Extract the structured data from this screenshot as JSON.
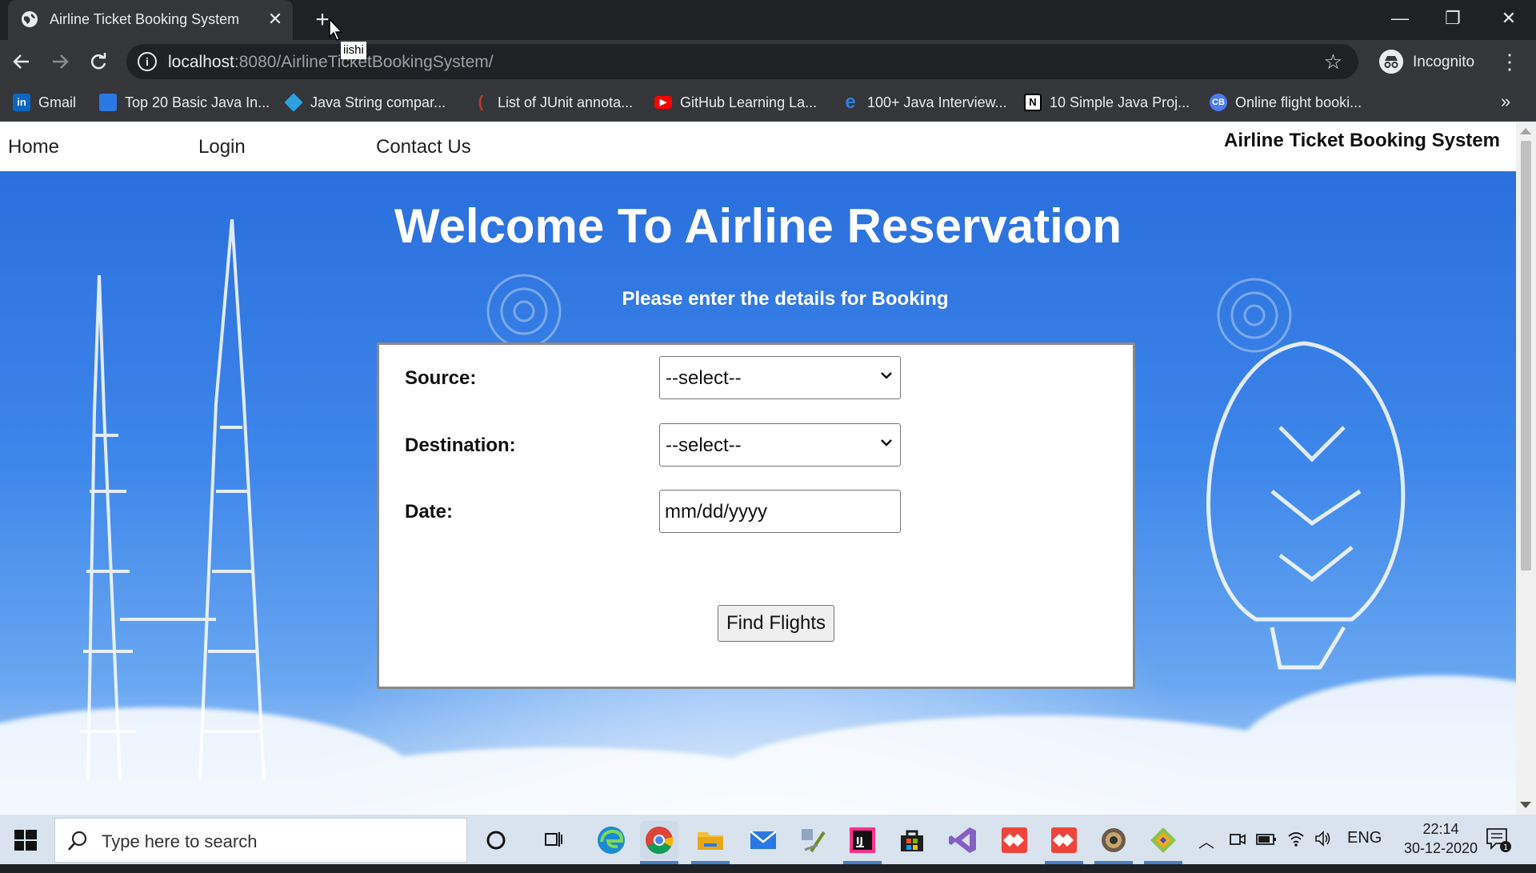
{
  "browser": {
    "tab_title": "Airline Ticket Booking System",
    "tab_close": "✕",
    "new_tab": "+",
    "tooltip": "iishi",
    "url_host": "localhost",
    "url_rest": ":8080/AirlineTicketBookingSystem/",
    "incognito_label": "Incognito",
    "window_controls": {
      "minimize": "—",
      "restore": "❐",
      "close": "✕"
    }
  },
  "bookmarks": [
    {
      "label": "Gmail",
      "icon": "linkedin-icon",
      "color": "#0a66c2",
      "glyph": "in"
    },
    {
      "label": "Top 20 Basic Java In...",
      "icon": "page-icon",
      "color": "#2b78e4",
      "glyph": ""
    },
    {
      "label": "Java String compar...",
      "icon": "diamond-icon",
      "color": "#2ea0e0",
      "glyph": ""
    },
    {
      "label": "List of JUnit annota...",
      "icon": "moon-icon",
      "color": "#7a2f2f",
      "glyph": "("
    },
    {
      "label": "GitHub Learning La...",
      "icon": "youtube-icon",
      "color": "#ff0000",
      "glyph": "▶"
    },
    {
      "label": "100+ Java Interview...",
      "icon": "edge-icon",
      "color": "#2f7fd6",
      "glyph": "e"
    },
    {
      "label": "10 Simple Java Proj...",
      "icon": "notion-icon",
      "color": "#ffffff",
      "glyph": "N"
    },
    {
      "label": "Online flight booki...",
      "icon": "cb-icon",
      "color": "#4b7bec",
      "glyph": "CB"
    }
  ],
  "bookmarks_more": "»",
  "site": {
    "nav": {
      "home": "Home",
      "login": "Login",
      "contact": "Contact Us"
    },
    "brand": "Airline Ticket Booking System",
    "heading": "Welcome To Airline Reservation",
    "subheading": "Please enter the details for Booking",
    "form": {
      "source_label": "Source:",
      "source_value": "--select--",
      "destination_label": "Destination:",
      "destination_value": "--select--",
      "date_label": "Date:",
      "date_placeholder": "mm/dd/yyyy",
      "submit_label": "Find Flights"
    }
  },
  "taskbar": {
    "search_placeholder": "Type here to search",
    "tray_language": "ENG",
    "time": "22:14",
    "date": "30-12-2020",
    "notification_count": "1",
    "apps": [
      {
        "name": "cortana-icon",
        "color": "transparent"
      },
      {
        "name": "task-view-icon",
        "color": "transparent"
      },
      {
        "name": "edge-icon",
        "color": "#1b8ad6"
      },
      {
        "name": "chrome-icon",
        "color": "#e3e3e3"
      },
      {
        "name": "file-explorer-icon",
        "color": "#f2c037"
      },
      {
        "name": "mail-icon",
        "color": "#2b78e4"
      },
      {
        "name": "tools-icon",
        "color": "#6b8e23"
      },
      {
        "name": "intellij-icon",
        "color": "#111111"
      },
      {
        "name": "store-icon",
        "color": "#1f1f1f"
      },
      {
        "name": "visual-studio-icon",
        "color": "#865fc5"
      },
      {
        "name": "anydesk-icon",
        "color": "#ef443b"
      },
      {
        "name": "anydesk2-icon",
        "color": "#ef443b"
      },
      {
        "name": "settings-gear-icon",
        "color": "#6b5b4b"
      },
      {
        "name": "git-icon",
        "color": "#8bc34a"
      }
    ]
  }
}
